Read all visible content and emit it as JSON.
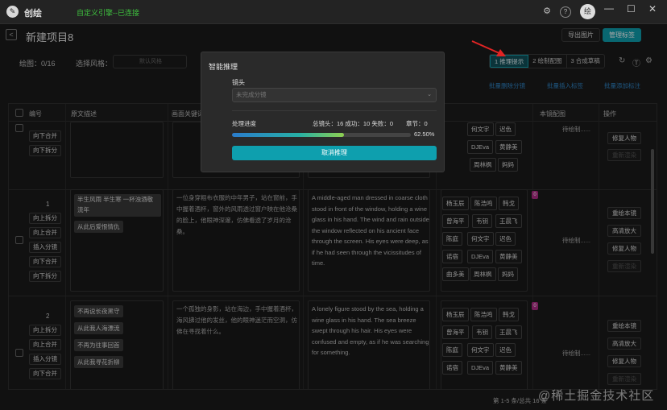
{
  "app": {
    "name": "创绘",
    "connection": "自定义引擎--已连接",
    "avatar": "绘"
  },
  "header": {
    "title": "新建项目8",
    "export_label": "导出图片",
    "manage_label": "管理标签"
  },
  "toolbar": {
    "drawing": "绘图：0/16",
    "style_label": "选择风格：",
    "style_placeholder": "默认风格",
    "steps": [
      "1 推理提示",
      "2 绘制配图",
      "3 合成草稿"
    ],
    "link_buttons": [
      "批量删除分镜",
      "批量插入标签",
      "批量添加标注"
    ]
  },
  "table": {
    "headers": [
      "编号",
      "原文描述",
      "画面关键词",
      "",
      "",
      "本镜配图",
      "操作"
    ],
    "row0": {
      "buttons": [
        "向下合并",
        "向下拆分"
      ],
      "tags": [
        [
          "杨玉辰",
          "陈浩鸣",
          "韩戈"
        ],
        [
          "曾海平",
          "韦钥",
          "王晨飞"
        ],
        [
          "陈庭",
          "何文宇",
          "迟色"
        ],
        [
          "诺宿",
          "DJEva",
          "黄静美"
        ],
        [
          "",
          "周林枫",
          "妈妈"
        ]
      ],
      "pending": "待绘制......",
      "actions": [
        "修复人物",
        "重新渲染"
      ]
    },
    "row1": {
      "num": "1",
      "buttons": [
        "向上拆分",
        "向上合并",
        "插入分镜",
        "向下合并",
        "向下拆分"
      ],
      "sentences": [
        "半生风雨 半生寒 一杯浊酒敬流年",
        "从此后爱恨情仇"
      ],
      "zh": "一位身穿粗布衣服的中年男子，站在窗前，手中握着酒杯，窗外的风雨透过窗户映在他沧桑的脸上，他眼神深邃，仿佛看透了岁月的沧桑。",
      "en": "A middle-aged man dressed in coarse cloth stood in front of the window, holding a wine glass in his hand. The wind and rain outside the window reflected on his ancient face through the screen. His eyes were deep, as if he had seen through the vicissitudes of time.",
      "badge": "0",
      "tags": [
        [
          "杨玉辰",
          "陈浩鸣",
          "韩戈"
        ],
        [
          "曾海平",
          "韦钥",
          "王晨飞"
        ],
        [
          "陈庭",
          "何文宇",
          "迟色"
        ],
        [
          "诺宿",
          "DJEva",
          "黄静美"
        ],
        [
          "曲多美",
          "周林枫",
          "妈妈"
        ]
      ],
      "pending": "待绘制......",
      "actions": [
        "重绘本镜",
        "高清放大",
        "修复人物",
        "重新渲染"
      ]
    },
    "row2": {
      "num": "2",
      "buttons": [
        "向上拆分",
        "向上合并",
        "插入分镜",
        "向下合并"
      ],
      "sentences": [
        "不再说长夜黑守",
        "从此我人海漂流",
        "不再为往事回首",
        "从此我寻花折柳"
      ],
      "zh": "一个孤独的身影，站在海边，手中握着酒杯，海风拂过他的发丝，他的眼神迷茫而空洞，仿佛在寻找着什么。",
      "en": "A lonely figure stood by the sea, holding a wine glass in his hand. The sea breeze swept through his hair. His eyes were confused and empty, as if he was searching for something.",
      "badge": "0",
      "tags": [
        [
          "杨玉辰",
          "陈浩鸣",
          "韩戈"
        ],
        [
          "曾海平",
          "韦钥",
          "王晨飞"
        ],
        [
          "陈庭",
          "何文宇",
          "迟色"
        ],
        [
          "诺宿",
          "DJEva",
          "黄静美"
        ]
      ],
      "pending": "待绘制......",
      "actions": [
        "重绘本镜",
        "高清放大",
        "修复人物",
        "重新渲染"
      ]
    }
  },
  "footer": {
    "page_info": "第 1-5 条/总共 16 条"
  },
  "watermark": "@稀土掘金技术社区",
  "modal": {
    "title": "智能推理",
    "shot_label": "镜头",
    "shot_placeholder": "未完成分镜",
    "progress_label": "处理进度",
    "stats": "总镜头：16 成功：10 失败：0",
    "chapter": "章节：0",
    "percent": "62.50%",
    "progress": 0.625,
    "cancel_label": "取消推理"
  },
  "colors": {
    "accent": "#0e9fae",
    "link": "#2f86c8",
    "connected": "#3fc23f",
    "badge": "#b02c86",
    "arrow": "#e02424"
  }
}
